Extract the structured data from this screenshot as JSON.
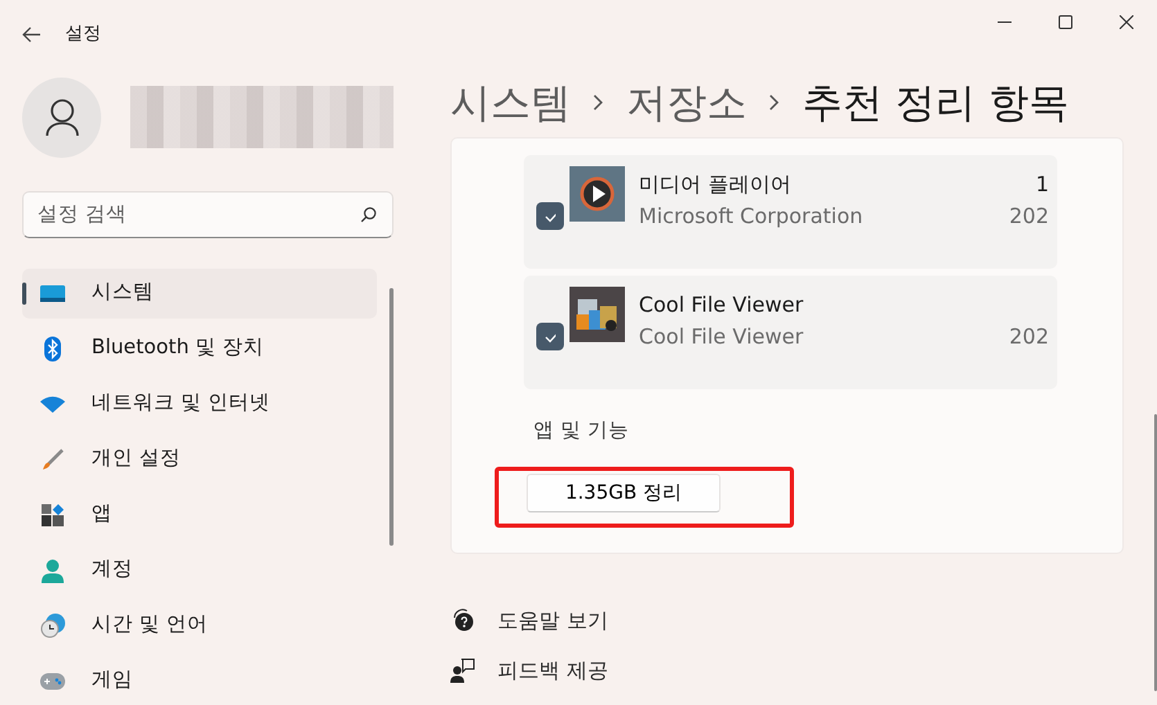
{
  "window": {
    "title": "설정"
  },
  "search": {
    "placeholder": "설정 검색"
  },
  "sidebar": {
    "items": [
      {
        "label": "시스템",
        "selected": true,
        "kind": "system"
      },
      {
        "label": "Bluetooth 및 장치",
        "selected": false,
        "kind": "bluetooth"
      },
      {
        "label": "네트워크 및 인터넷",
        "selected": false,
        "kind": "network"
      },
      {
        "label": "개인 설정",
        "selected": false,
        "kind": "brush"
      },
      {
        "label": "앱",
        "selected": false,
        "kind": "apps"
      },
      {
        "label": "계정",
        "selected": false,
        "kind": "account"
      },
      {
        "label": "시간 및 언어",
        "selected": false,
        "kind": "time"
      },
      {
        "label": "게임",
        "selected": false,
        "kind": "game"
      }
    ]
  },
  "breadcrumb": [
    "시스템",
    "저장소",
    "추천 정리 항목"
  ],
  "apps": [
    {
      "name": "미디어 플레이어",
      "publisher": "Microsoft Corporation",
      "size": "1",
      "date": "202",
      "checked": true,
      "kind": "media"
    },
    {
      "name": "Cool File Viewer",
      "publisher": "Cool File Viewer",
      "date": "202",
      "checked": true,
      "kind": "viewer"
    }
  ],
  "apps_link": "앱 및 기능",
  "cleanup_button": "1.35GB 정리",
  "help_links": [
    {
      "label": "도움말 보기",
      "kind": "help"
    },
    {
      "label": "피드백 제공",
      "kind": "feedback"
    }
  ]
}
